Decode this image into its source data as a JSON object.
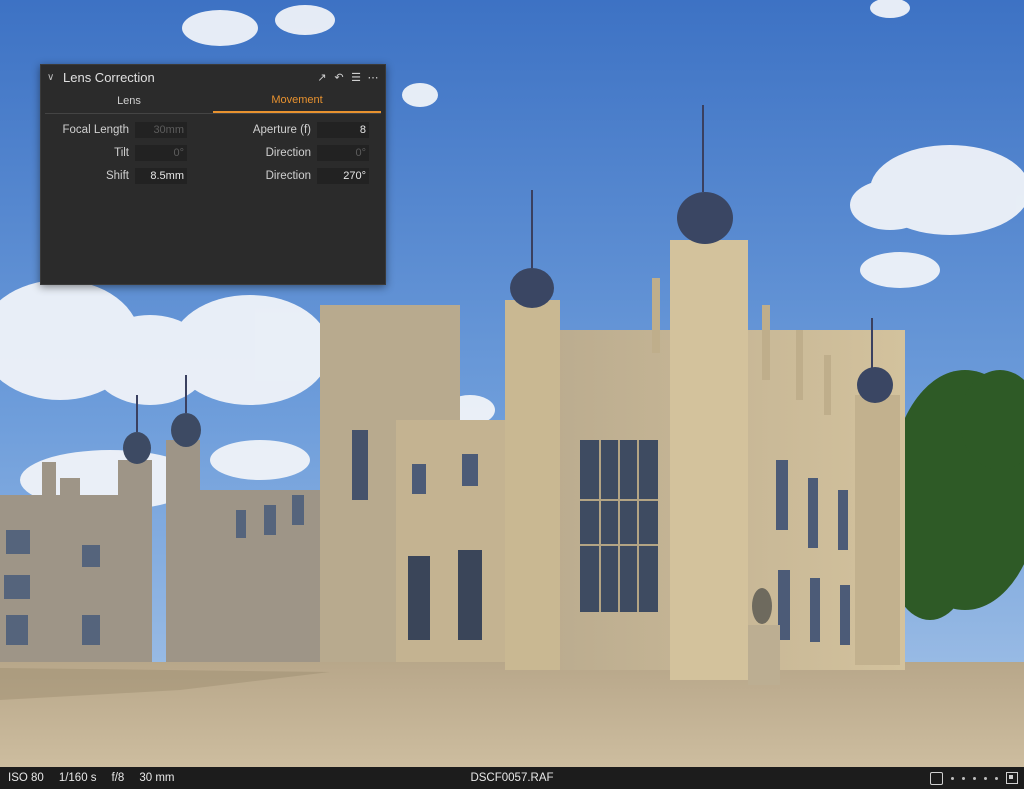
{
  "panel": {
    "title": "Lens Correction",
    "tabs": [
      {
        "label": "Lens",
        "active": false
      },
      {
        "label": "Movement",
        "active": true
      }
    ],
    "rows": [
      {
        "left_label": "Focal Length",
        "left_value": "30mm",
        "left_dim": true,
        "right_label": "Aperture (f)",
        "right_value": "8",
        "right_dim": false
      },
      {
        "left_label": "Tilt",
        "left_value": "0°",
        "left_dim": true,
        "right_label": "Direction",
        "right_value": "0°",
        "right_dim": true
      },
      {
        "left_label": "Shift",
        "left_value": "8.5mm",
        "left_dim": false,
        "right_label": "Direction",
        "right_value": "270°",
        "right_dim": false
      }
    ],
    "accent_color": "#e8922f"
  },
  "status": {
    "iso": "ISO 80",
    "shutter": "1/160 s",
    "aperture": "f/8",
    "focal": "30 mm",
    "filename": "DSCF0057.RAF"
  }
}
